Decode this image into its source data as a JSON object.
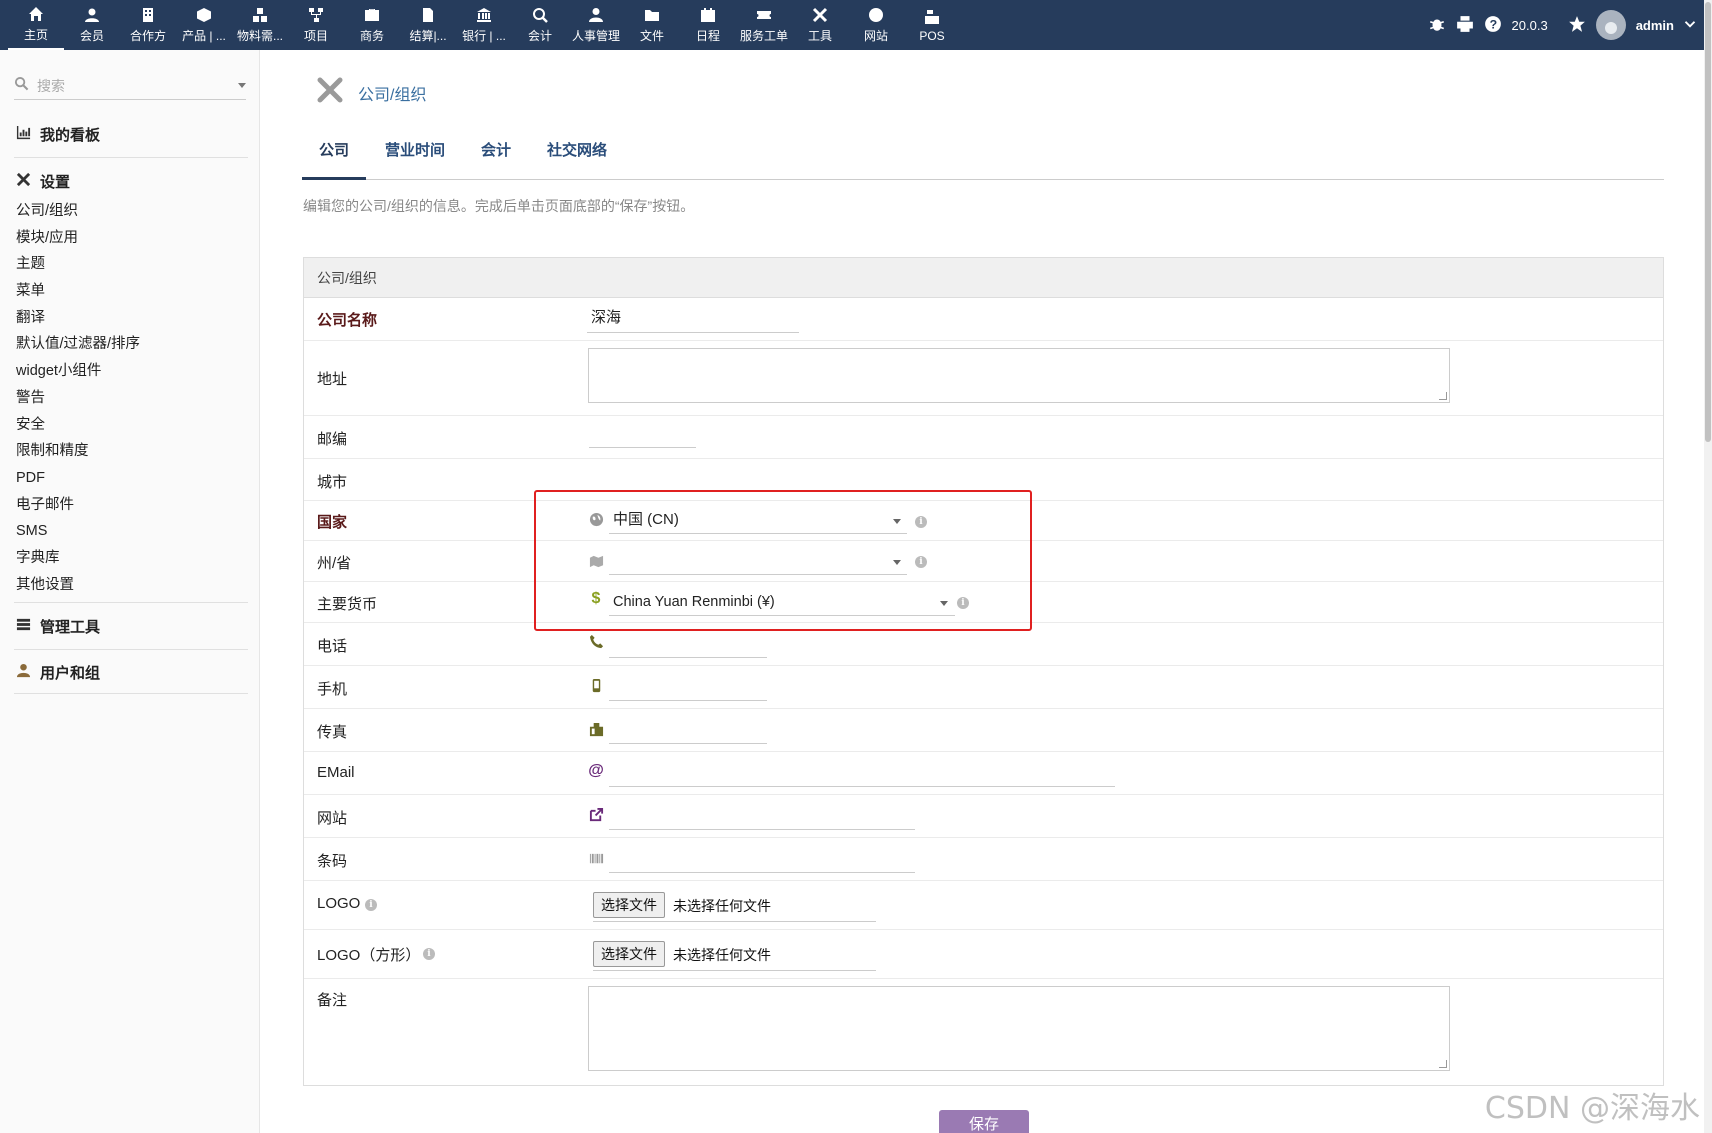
{
  "topnav": {
    "items": [
      {
        "label": "主页",
        "icon": "home-icon"
      },
      {
        "label": "会员",
        "icon": "user-icon"
      },
      {
        "label": "合作方",
        "icon": "building-icon"
      },
      {
        "label": "产品 | ...",
        "icon": "cube-icon"
      },
      {
        "label": "物料需...",
        "icon": "cubes-icon"
      },
      {
        "label": "项目",
        "icon": "sitemap-icon"
      },
      {
        "label": "商务",
        "icon": "briefcase-icon"
      },
      {
        "label": "结算|...",
        "icon": "invoice-icon"
      },
      {
        "label": "银行 | ...",
        "icon": "bank-icon"
      },
      {
        "label": "会计",
        "icon": "search-dollar-icon"
      },
      {
        "label": "人事管理",
        "icon": "user-tie-icon"
      },
      {
        "label": "文件",
        "icon": "folder-icon"
      },
      {
        "label": "日程",
        "icon": "calendar-icon"
      },
      {
        "label": "服务工单",
        "icon": "ticket-icon"
      },
      {
        "label": "工具",
        "icon": "tools-icon"
      },
      {
        "label": "网站",
        "icon": "globe-icon"
      },
      {
        "label": "POS",
        "icon": "cash-register-icon"
      }
    ],
    "version": "20.0.3",
    "user": "admin"
  },
  "sidebar": {
    "search_placeholder": "搜索",
    "dashboard": "我的看板",
    "settings": "设置",
    "settings_items": [
      "公司/组织",
      "模块/应用",
      "主题",
      "菜单",
      "翻译",
      "默认值/过滤器/排序",
      "widget小组件",
      "警告",
      "安全",
      "限制和精度",
      "PDF",
      "电子邮件",
      "SMS",
      "字典库",
      "其他设置"
    ],
    "admin_tools": "管理工具",
    "users_groups": "用户和组"
  },
  "page": {
    "title": "公司/组织",
    "tabs": [
      "公司",
      "营业时间",
      "会计",
      "社交网络"
    ],
    "description": "编辑您的公司/组织的信息。完成后单击页面底部的“保存”按钮。",
    "card_title": "公司/组织",
    "save_label": "保存"
  },
  "form": {
    "company_name_label": "公司名称",
    "company_name_value": "深海",
    "address_label": "地址",
    "zip_label": "邮编",
    "city_label": "城市",
    "country_label": "国家",
    "country_value": "中国 (CN)",
    "state_label": "州/省",
    "state_value": "",
    "currency_label": "主要货币",
    "currency_value": "China Yuan Renminbi (¥)",
    "phone_label": "电话",
    "mobile_label": "手机",
    "fax_label": "传真",
    "email_label": "EMail",
    "website_label": "网站",
    "barcode_label": "条码",
    "logo_label": "LOGO",
    "logo_square_label": "LOGO（方形）",
    "file_button": "选择文件",
    "no_file": "未选择任何文件",
    "notes_label": "备注"
  },
  "watermark": "CSDN @深海水"
}
